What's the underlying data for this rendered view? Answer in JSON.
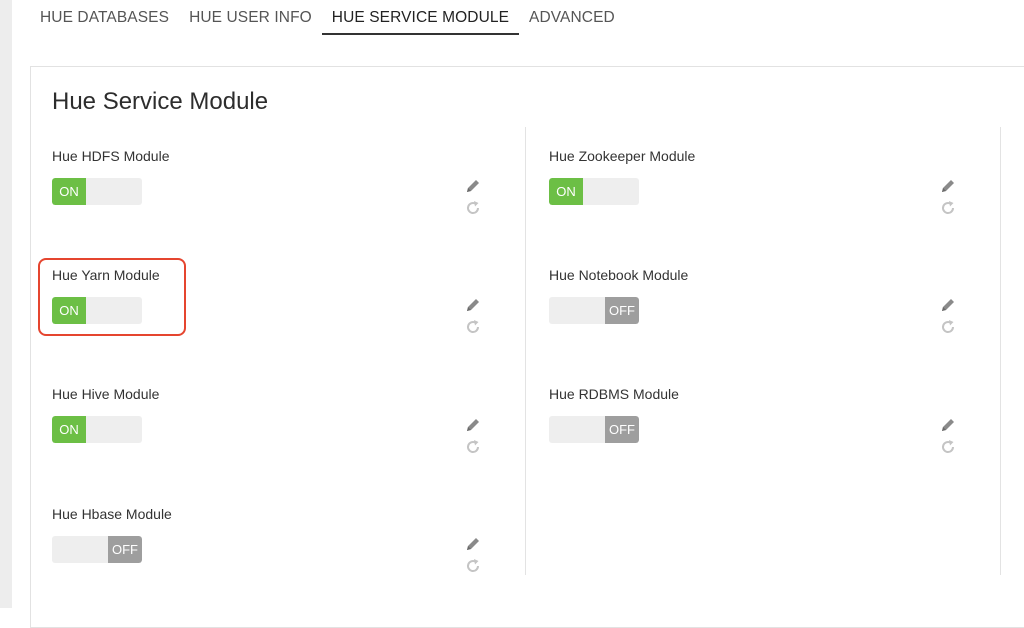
{
  "tabs": [
    {
      "label": "HUE DATABASES",
      "active": false
    },
    {
      "label": "HUE USER INFO",
      "active": false
    },
    {
      "label": "HUE SERVICE MODULE",
      "active": true
    },
    {
      "label": "ADVANCED",
      "active": false
    }
  ],
  "panel": {
    "title": "Hue Service Module"
  },
  "modules": {
    "hdfs": {
      "label": "Hue HDFS Module",
      "state": "ON"
    },
    "yarn": {
      "label": "Hue Yarn Module",
      "state": "ON"
    },
    "hive": {
      "label": "Hue Hive Module",
      "state": "ON"
    },
    "hbase": {
      "label": "Hue Hbase Module",
      "state": "OFF"
    },
    "zookeeper": {
      "label": "Hue Zookeeper Module",
      "state": "ON"
    },
    "notebook": {
      "label": "Hue Notebook Module",
      "state": "OFF"
    },
    "rdbms": {
      "label": "Hue RDBMS Module",
      "state": "OFF"
    }
  },
  "icons": {
    "edit": "pencil-icon",
    "reset": "refresh-icon"
  },
  "colors": {
    "on": "#6cbf45",
    "off": "#9e9e9e",
    "highlight": "#e5452f"
  }
}
